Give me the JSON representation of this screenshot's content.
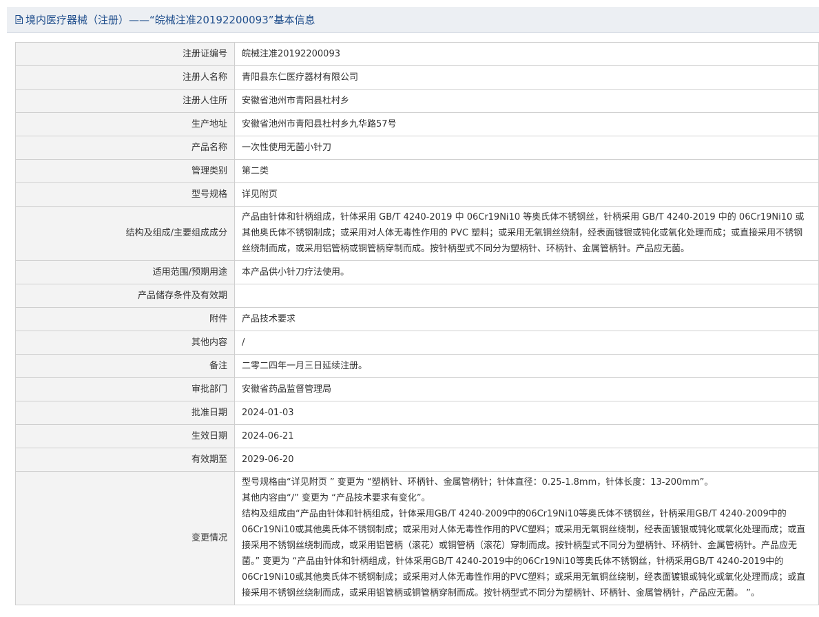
{
  "header": {
    "title": "境内医疗器械（注册）——“皖械注准20192200093”基本信息"
  },
  "rows": [
    {
      "label": "注册证编号",
      "value": "皖械注准20192200093"
    },
    {
      "label": "注册人名称",
      "value": "青阳县东仁医疗器材有限公司"
    },
    {
      "label": "注册人住所",
      "value": "安徽省池州市青阳县杜村乡"
    },
    {
      "label": "生产地址",
      "value": "安徽省池州市青阳县杜村乡九华路57号"
    },
    {
      "label": "产品名称",
      "value": "一次性使用无菌小针刀"
    },
    {
      "label": "管理类别",
      "value": "第二类"
    },
    {
      "label": "型号规格",
      "value": "详见附页"
    },
    {
      "label": "结构及组成/主要组成成分",
      "value": "产品由针体和针柄组成，针体采用 GB/T 4240-2019 中 06Cr19Ni10 等奥氏体不锈钢丝，针柄采用 GB/T 4240-2019 中的 06Cr19Ni10 或其他奥氏体不锈钢制成；或采用对人体无毒性作用的 PVC 塑料；或采用无氧铜丝绕制，经表面镀银或钝化或氧化处理而成；或直接采用不锈钢丝绕制而成，或采用铝管柄或铜管柄穿制而成。按针柄型式不同分为塑柄针、环柄针、金属管柄针。产品应无菌。"
    },
    {
      "label": "适用范围/预期用途",
      "value": "本产品供小针刀疗法使用。"
    },
    {
      "label": "产品储存条件及有效期",
      "value": ""
    },
    {
      "label": "附件",
      "value": "产品技术要求"
    },
    {
      "label": "其他内容",
      "value": "/"
    },
    {
      "label": "备注",
      "value": "二零二四年一月三日延续注册。"
    },
    {
      "label": "审批部门",
      "value": "安徽省药品监督管理局"
    },
    {
      "label": "批准日期",
      "value": "2024-01-03"
    },
    {
      "label": "生效日期",
      "value": "2024-06-21"
    },
    {
      "label": "有效期至",
      "value": "2029-06-20"
    }
  ],
  "changes": {
    "label": "变更情况",
    "lines": [
      "型号规格由“详见附页 ” 变更为 “塑柄针、环柄针、金属管柄针；针体直径：0.25-1.8mm，针体长度：13-200mm”。",
      "其他内容由“/” 变更为 “产品技术要求有变化”。",
      "结构及组成由“产品由针体和针柄组成，针体采用GB/T 4240-2009中的06Cr19Ni10等奥氏体不锈钢丝，针柄采用GB/T 4240-2009中的06Cr19Ni10或其他奥氏体不锈钢制成；或采用对人体无毒性作用的PVC塑料；或采用无氧铜丝绕制，经表面镀银或钝化或氧化处理而成；或直接采用不锈钢丝绕制而成，或采用铝管柄（滚花）或铜管柄（滚花）穿制而成。按针柄型式不同分为塑柄针、环柄针、金属管柄针。产品应无菌。” 变更为 “产品由针体和针柄组成，针体采用GB/T 4240-2019中的06Cr19Ni10等奥氏体不锈钢丝，针柄采用GB/T 4240-2019中的06Cr19Ni10或其他奥氏体不锈钢制成；或采用对人体无毒性作用的PVC塑料；或采用无氧铜丝绕制，经表面镀银或钝化或氧化处理而成；或直接采用不锈钢丝绕制而成，或采用铝管柄或铜管柄穿制而成。按针柄型式不同分为塑柄针、环柄针、金属管柄针，产品应无菌。 ”。"
    ]
  }
}
